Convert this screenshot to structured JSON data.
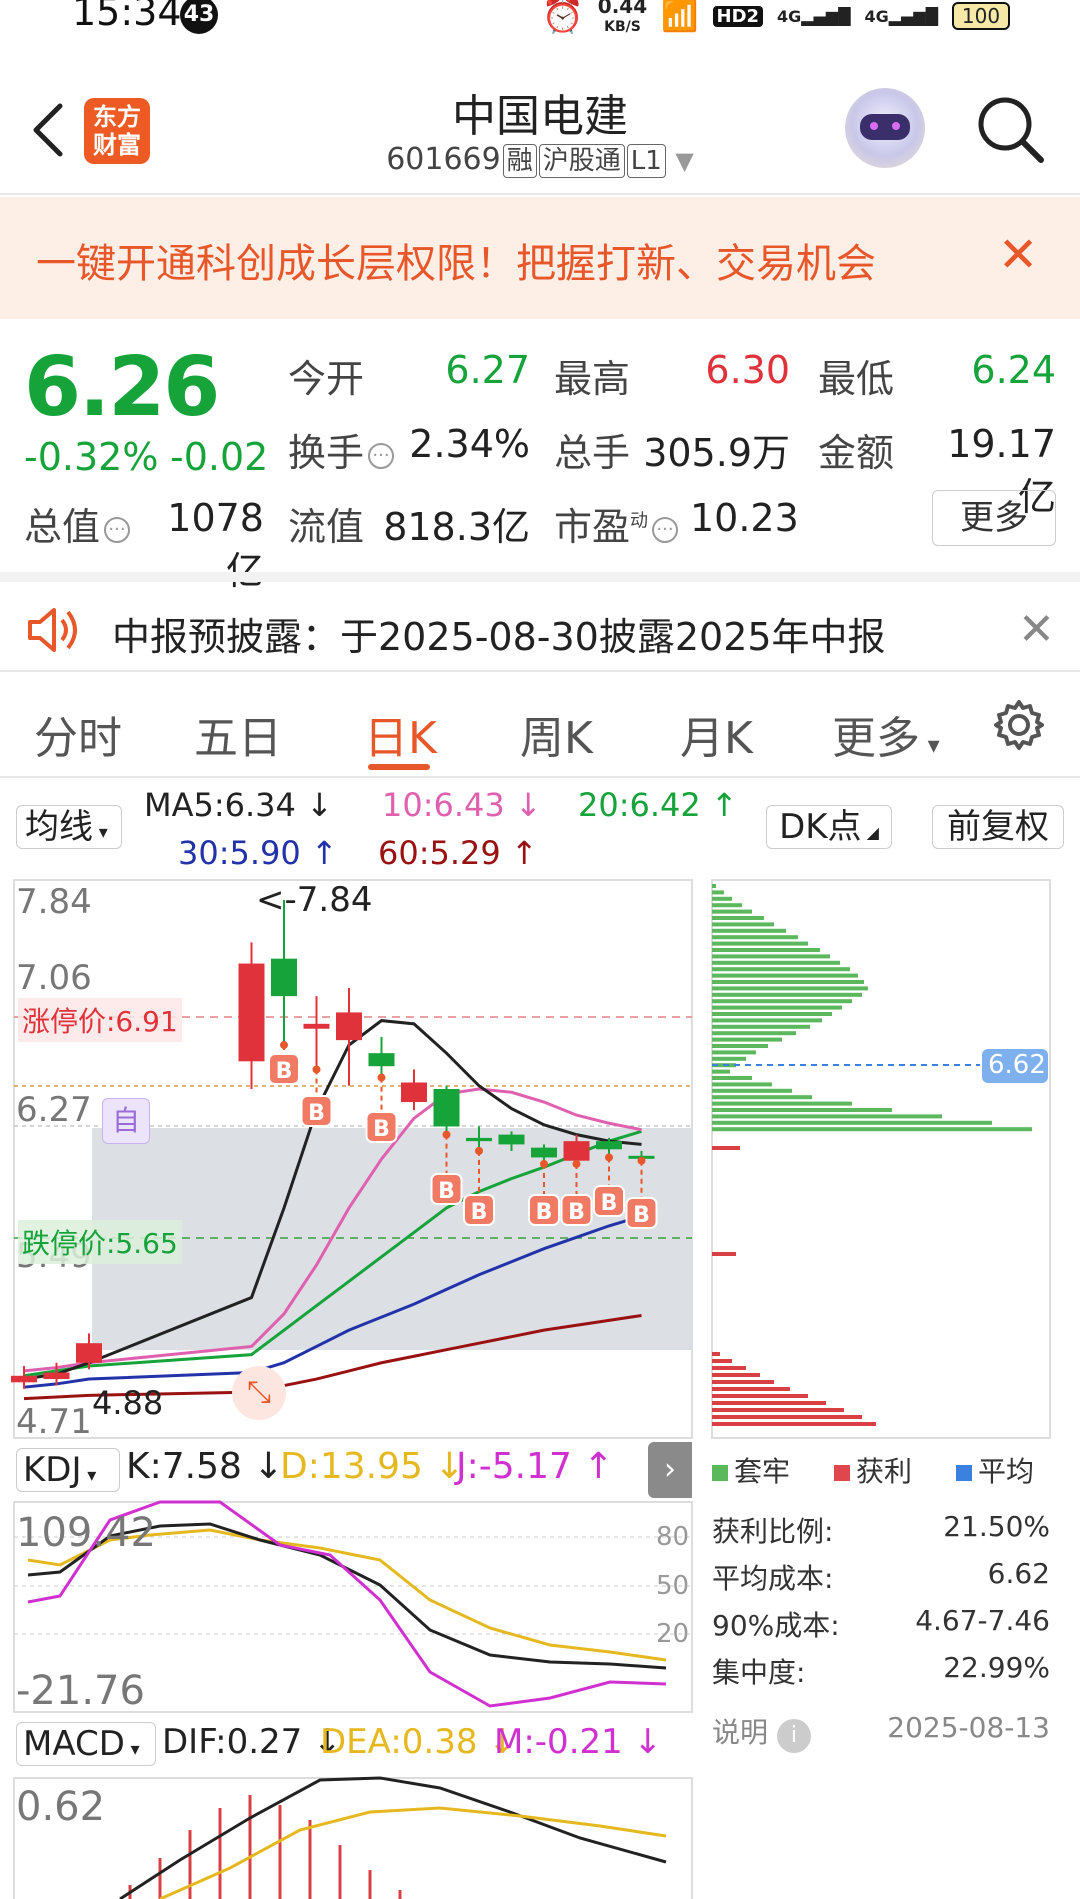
{
  "status_bar": {
    "time": "15:34",
    "badge": "43",
    "speed": "0.44",
    "speed_unit": "KB/S",
    "hd": "HD2",
    "net1": "4G",
    "net2": "4G",
    "battery": "100"
  },
  "header": {
    "title": "中国电建",
    "code": "601669",
    "tags": [
      "融",
      "沪股通",
      "L1"
    ],
    "logo": "东方财富"
  },
  "banner": {
    "text": "一键开通科创成长层权限！把握打新、交易机会"
  },
  "quote": {
    "price": "6.26",
    "change_pct": "-0.32%",
    "change": "-0.02",
    "open_label": "今开",
    "open": "6.27",
    "high_label": "最高",
    "high": "6.30",
    "low_label": "最低",
    "low": "6.24",
    "turnover_label": "换手",
    "turnover": "2.34%",
    "volume_label": "总手",
    "volume": "305.9万",
    "amount_label": "金额",
    "amount": "19.17亿",
    "mktcap_label": "总值",
    "mktcap": "1078亿",
    "float_label": "流值",
    "float": "818.3亿",
    "pe_label": "市盈",
    "pe_sup": "动",
    "pe": "10.23",
    "more": "更多",
    "colors": {
      "up": "#e0323a",
      "down": "#15a33a"
    }
  },
  "notice": {
    "text": "中报预披露：于2025-08-30披露2025年中报"
  },
  "tabs": [
    "分时",
    "五日",
    "日K",
    "周K",
    "月K",
    "更多"
  ],
  "active_tab": "日K",
  "ma_bar": {
    "selector": "均线",
    "ma5": "MA5:6.34",
    "ma10": "10:6.43",
    "ma20": "20:6.42",
    "ma30": "30:5.90",
    "ma60": "60:5.29",
    "dk": "DK点",
    "adjust": "前复权",
    "colors": {
      "ma5": "#222222",
      "ma10": "#e060b0",
      "ma20": "#15a33a",
      "ma30": "#2233aa",
      "ma60": "#991111"
    }
  },
  "kline": {
    "y_labels": [
      "7.84",
      "7.06",
      "6.27",
      "5.49",
      "4.71"
    ],
    "limit_up": "涨停价:6.91",
    "limit_down": "跌停价:5.65",
    "max_label": "<-7.84",
    "min_label": "4.88",
    "self_tag": "自",
    "buy_marker": "B",
    "chip_price": "6.62"
  },
  "chart_data": {
    "type": "candlestick",
    "ylim": [
      4.71,
      7.84
    ],
    "candles": [
      {
        "o": 4.88,
        "c": 4.92,
        "h": 4.98,
        "l": 4.84
      },
      {
        "o": 4.9,
        "c": 4.94,
        "h": 5.0,
        "l": 4.86
      },
      {
        "o": 5.0,
        "c": 5.12,
        "h": 5.18,
        "l": 4.96
      },
      {
        "o": 6.85,
        "c": 7.45,
        "h": 7.58,
        "l": 6.68
      },
      {
        "o": 7.48,
        "c": 7.25,
        "h": 7.84,
        "l": 6.95
      },
      {
        "o": 7.05,
        "c": 7.08,
        "h": 7.25,
        "l": 6.8
      },
      {
        "o": 6.98,
        "c": 7.15,
        "h": 7.3,
        "l": 6.7
      },
      {
        "o": 6.9,
        "c": 6.82,
        "h": 7.0,
        "l": 6.75
      },
      {
        "o": 6.6,
        "c": 6.72,
        "h": 6.8,
        "l": 6.55
      },
      {
        "o": 6.68,
        "c": 6.45,
        "h": 6.7,
        "l": 6.4
      },
      {
        "o": 6.38,
        "c": 6.36,
        "h": 6.45,
        "l": 6.3
      },
      {
        "o": 6.4,
        "c": 6.34,
        "h": 6.42,
        "l": 6.3
      },
      {
        "o": 6.32,
        "c": 6.26,
        "h": 6.34,
        "l": 6.22
      },
      {
        "o": 6.24,
        "c": 6.36,
        "h": 6.4,
        "l": 6.22
      },
      {
        "o": 6.36,
        "c": 6.31,
        "h": 6.38,
        "l": 6.26
      },
      {
        "o": 6.27,
        "c": 6.26,
        "h": 6.3,
        "l": 6.24
      }
    ],
    "ma5": [
      4.9,
      4.93,
      5.0,
      5.4,
      5.95,
      6.55,
      6.95,
      7.1,
      7.08,
      6.9,
      6.7,
      6.56,
      6.46,
      6.4,
      6.36,
      6.34
    ],
    "ma10": [
      4.95,
      4.97,
      5.0,
      5.1,
      5.3,
      5.6,
      5.95,
      6.25,
      6.5,
      6.65,
      6.68,
      6.66,
      6.6,
      6.52,
      6.47,
      6.43
    ],
    "ma20": [
      4.92,
      4.95,
      4.98,
      5.05,
      5.2,
      5.35,
      5.5,
      5.65,
      5.8,
      5.95,
      6.05,
      6.13,
      6.2,
      6.28,
      6.36,
      6.42
    ],
    "ma30": [
      4.85,
      4.87,
      4.9,
      4.94,
      5.0,
      5.1,
      5.2,
      5.28,
      5.36,
      5.45,
      5.54,
      5.62,
      5.7,
      5.77,
      5.84,
      5.9
    ],
    "ma60": [
      4.78,
      4.79,
      4.8,
      4.82,
      4.86,
      4.9,
      4.95,
      5.0,
      5.04,
      5.08,
      5.12,
      5.16,
      5.2,
      5.23,
      5.26,
      5.29
    ]
  },
  "kdj": {
    "selector": "KDJ",
    "k": "K:7.58",
    "d": "D:13.95",
    "j": "J:-5.17",
    "max": "109.42",
    "min": "-21.76",
    "levels": [
      "80",
      "50",
      "20"
    ]
  },
  "macd": {
    "selector": "MACD",
    "dif": "DIF:0.27",
    "dea": "DEA:0.38",
    "m": "M:-0.21",
    "max": "0.62"
  },
  "chips": {
    "legend": [
      "套牢",
      "获利",
      "平均"
    ],
    "legend_colors": [
      "#5cb85c",
      "#e0474c",
      "#3b82e0"
    ],
    "profit_ratio_label": "获利比例:",
    "profit_ratio": "21.50%",
    "avg_cost_label": "平均成本:",
    "avg_cost": "6.62",
    "cost90_label": "90%成本:",
    "cost90": "4.67-7.46",
    "concentration_label": "集中度:",
    "concentration": "22.99%",
    "note": "说明",
    "date": "2025-08-13"
  }
}
